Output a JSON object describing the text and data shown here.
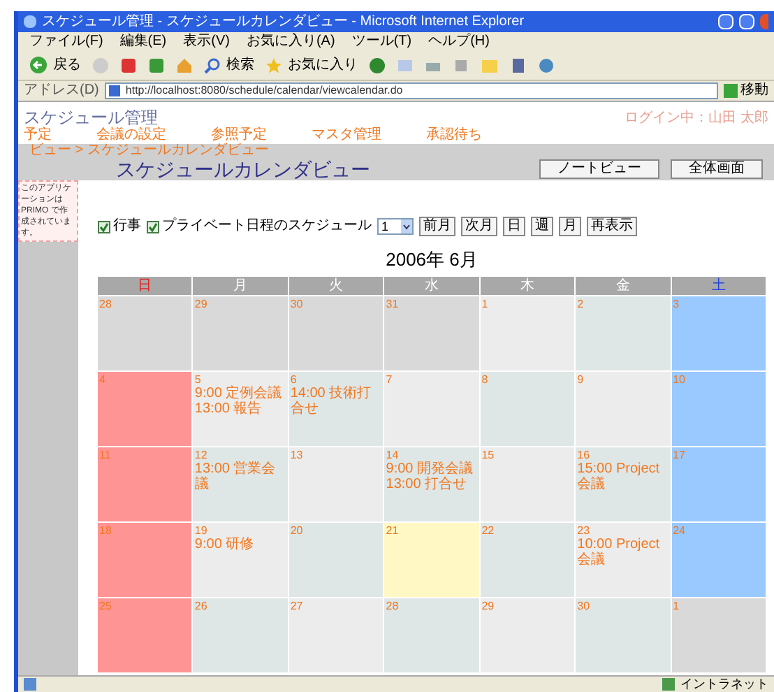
{
  "window": {
    "title": "スケジュール管理 - スケジュールカレンダビュー - Microsoft Internet Explorer"
  },
  "menu": [
    "ファイル(F)",
    "編集(E)",
    "表示(V)",
    "お気に入り(A)",
    "ツール(T)",
    "ヘルプ(H)"
  ],
  "toolbar": {
    "back": "戻る",
    "search": "検索",
    "favorites": "お気に入り"
  },
  "address": {
    "label": "アドレス(D)",
    "url": "http://localhost:8080/schedule/calendar/viewcalendar.do",
    "go": "移動"
  },
  "app": {
    "title": "スケジュール管理",
    "user": "ログイン中：山田 太郎"
  },
  "nav": [
    "予定",
    "会議の設定",
    "参照予定",
    "マスタ管理",
    "承認待ち"
  ],
  "breadcrumb": "ビュー > スケジュールカレンダビュー",
  "page_title": "スケジュールカレンダビュー",
  "header_buttons": [
    "ノートビュー",
    "全体画面"
  ],
  "side_note": "このアプリケーションは PRIMO で作成されています。",
  "filters": [
    {
      "label": "行事",
      "checked": true
    },
    {
      "label": "プライベート日程のスケジュール",
      "checked": true
    }
  ],
  "select": {
    "value": "1"
  },
  "nav_buttons": [
    "前月",
    "次月",
    "日",
    "週",
    "月",
    "再表示"
  ],
  "month": "2006年 6月",
  "weekdays": [
    "日",
    "月",
    "火",
    "水",
    "木",
    "金",
    "土"
  ],
  "weeks": [
    [
      {
        "day": "28",
        "kind": "outside"
      },
      {
        "day": "29",
        "kind": "outside"
      },
      {
        "day": "30",
        "kind": "outside"
      },
      {
        "day": "31",
        "kind": "outside"
      },
      {
        "day": "1",
        "kind": "weekday"
      },
      {
        "day": "2",
        "kind": "weekday"
      },
      {
        "day": "3",
        "kind": "saturday"
      }
    ],
    [
      {
        "day": "4",
        "kind": "sunday"
      },
      {
        "day": "5",
        "kind": "weekday",
        "events": [
          "9:00 定例会議",
          "13:00 報告"
        ]
      },
      {
        "day": "6",
        "kind": "weekday",
        "events": [
          "14:00 技術打合せ"
        ]
      },
      {
        "day": "7",
        "kind": "weekday"
      },
      {
        "day": "8",
        "kind": "weekday"
      },
      {
        "day": "9",
        "kind": "weekday"
      },
      {
        "day": "10",
        "kind": "saturday"
      }
    ],
    [
      {
        "day": "11",
        "kind": "sunday"
      },
      {
        "day": "12",
        "kind": "weekday",
        "events": [
          "13:00 営業会議"
        ]
      },
      {
        "day": "13",
        "kind": "weekday"
      },
      {
        "day": "14",
        "kind": "weekday",
        "events": [
          "9:00 開発会議",
          "13:00 打合せ"
        ]
      },
      {
        "day": "15",
        "kind": "weekday"
      },
      {
        "day": "16",
        "kind": "weekday",
        "events": [
          "15:00 Project会議"
        ]
      },
      {
        "day": "17",
        "kind": "saturday"
      }
    ],
    [
      {
        "day": "18",
        "kind": "sunday"
      },
      {
        "day": "19",
        "kind": "weekday",
        "events": [
          "9:00 研修"
        ]
      },
      {
        "day": "20",
        "kind": "weekday"
      },
      {
        "day": "21",
        "kind": "today"
      },
      {
        "day": "22",
        "kind": "weekday"
      },
      {
        "day": "23",
        "kind": "weekday",
        "events": [
          "10:00 Project会議"
        ]
      },
      {
        "day": "24",
        "kind": "saturday"
      }
    ],
    [
      {
        "day": "25",
        "kind": "sunday"
      },
      {
        "day": "26",
        "kind": "weekday"
      },
      {
        "day": "27",
        "kind": "weekday"
      },
      {
        "day": "28",
        "kind": "weekday"
      },
      {
        "day": "29",
        "kind": "weekday"
      },
      {
        "day": "30",
        "kind": "weekday"
      },
      {
        "day": "1",
        "kind": "outside"
      }
    ]
  ],
  "status_bar": {
    "zone": "イントラネット"
  }
}
